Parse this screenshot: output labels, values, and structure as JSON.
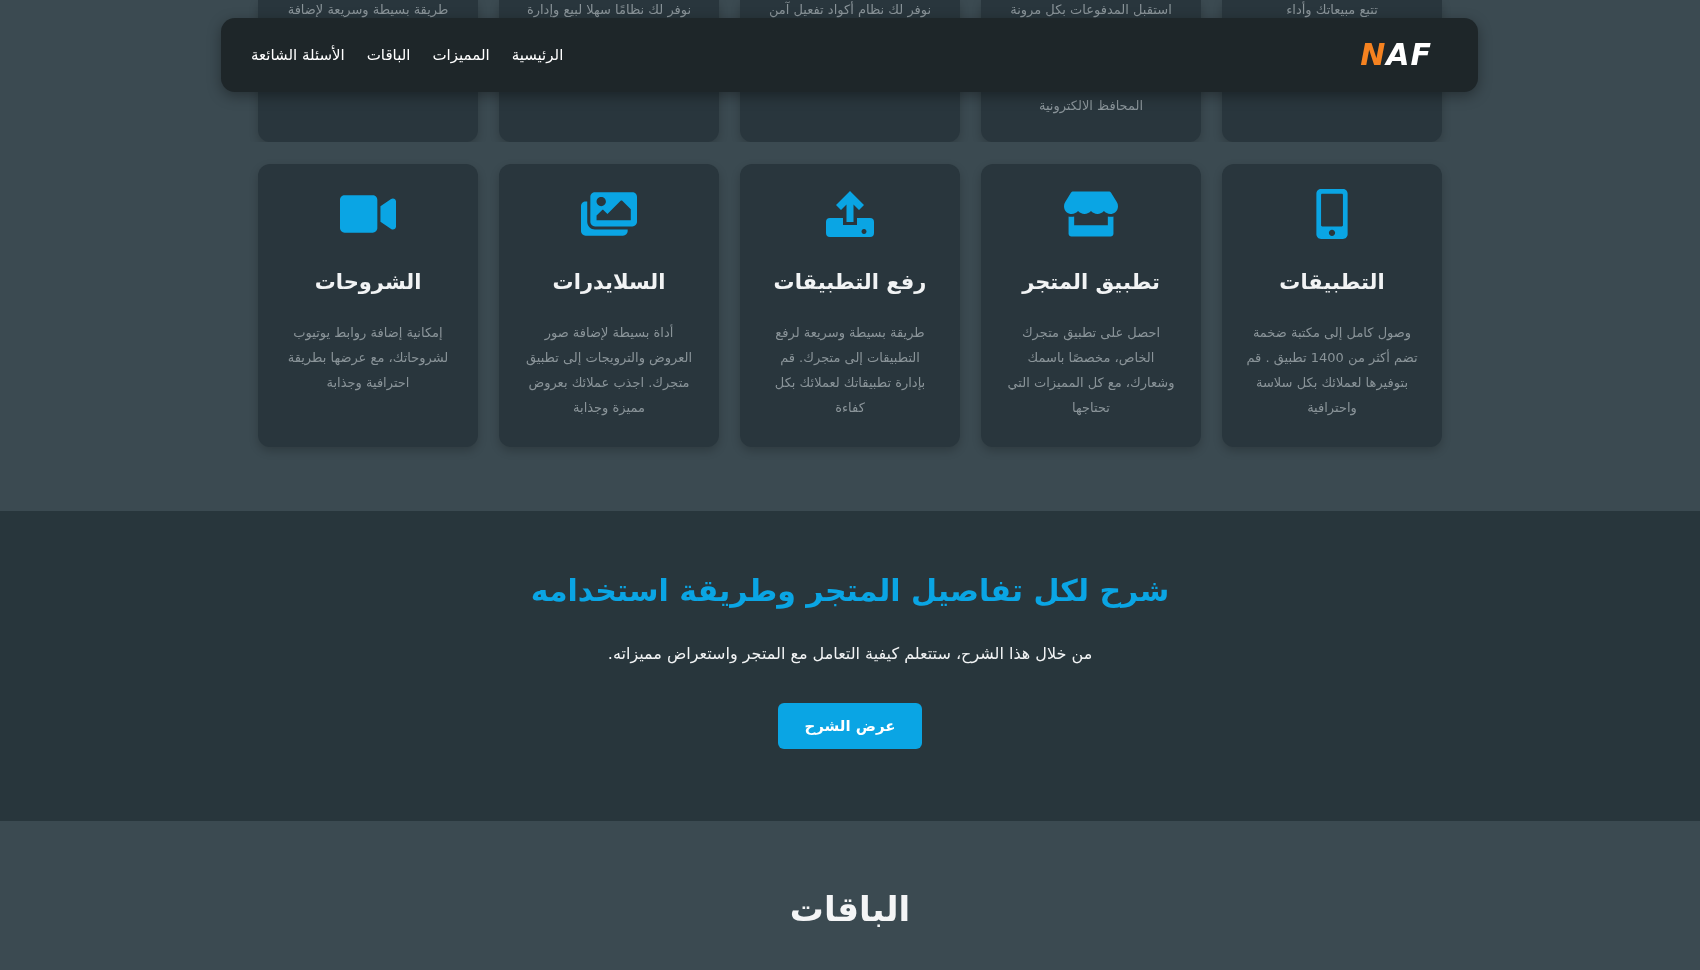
{
  "nav": {
    "logo": "NAF",
    "links": [
      {
        "label": "الرئيسية"
      },
      {
        "label": "المميزات"
      },
      {
        "label": "الباقات"
      },
      {
        "label": "الأسئلة الشائعة"
      }
    ]
  },
  "top_cards": [
    {
      "text_top": "تتبع مبيعاتك وأداء"
    },
    {
      "text_top": "استقبل المدفوعات بكل مرونة",
      "text_bottom": "المحافظ الالكترونية"
    },
    {
      "text_top": "نوفر لك نظام أكواد تفعيل آمن"
    },
    {
      "text_top": "نوفر لك نظامًا سهلا لبيع وإدارة"
    },
    {
      "text_top": "طريقة بسيطة وسريعة لإضافة"
    }
  ],
  "features": [
    {
      "title": "التطبيقات",
      "description": "وصول كامل إلى مكتبة ضخمة تضم أكثر من 1400 تطبيق . قم بتوفيرها لعملائك بكل سلاسة واحترافية"
    },
    {
      "title": "تطبيق المتجر",
      "description": "احصل على تطبيق متجرك الخاص، مخصصًا باسمك وشعارك، مع كل المميزات التي تحتاجها"
    },
    {
      "title": "رفع التطبيقات",
      "description": "طريقة بسيطة وسريعة لرفع التطبيقات إلى متجرك. قم بإدارة تطبيقاتك لعملائك بكل كفاءة"
    },
    {
      "title": "السلايدرات",
      "description": "أداة بسيطة لإضافة صور العروض والترويجات إلى تطبيق متجرك. اجذب عملائك بعروض مميزة وجذابة"
    },
    {
      "title": "الشروحات",
      "description": "إمكانية إضافة روابط يوتيوب لشروحاتك، مع عرضها بطريقة احترافية وجذابة"
    }
  ],
  "tutorial": {
    "heading": "شرح لكل تفاصيل المتجر وطريقة استخدامه",
    "text": "من خلال هذا الشرح، ستتعلم كيفية التعامل مع المتجر واستعراض مميزاته.",
    "button": "عرض الشرح"
  },
  "plans": {
    "heading": "الباقات"
  }
}
